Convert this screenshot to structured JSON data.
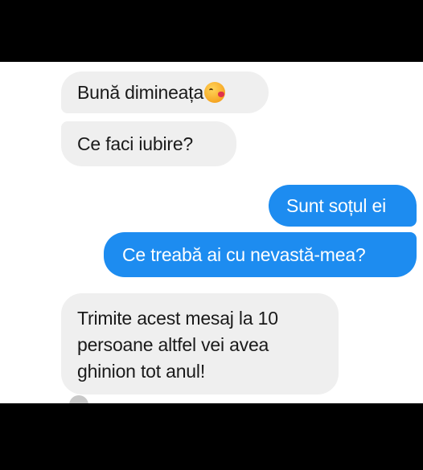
{
  "messages": [
    {
      "direction": "incoming",
      "text": "Bună dimineața",
      "emoji": "kissing-face-emoji"
    },
    {
      "direction": "incoming",
      "text": "Ce faci iubire?"
    },
    {
      "direction": "outgoing",
      "text": "Sunt soțul ei"
    },
    {
      "direction": "outgoing",
      "text": "Ce treabă ai cu nevastă-mea?"
    },
    {
      "direction": "incoming",
      "line1": "Trimite acest mesaj la 10",
      "line2": "persoane altfel vei avea",
      "line3": "ghinion tot anul!"
    }
  ],
  "colors": {
    "incoming_bubble": "#efefef",
    "outgoing_bubble": "#1d8cf0",
    "background": "#ffffff",
    "frame": "#000000"
  }
}
